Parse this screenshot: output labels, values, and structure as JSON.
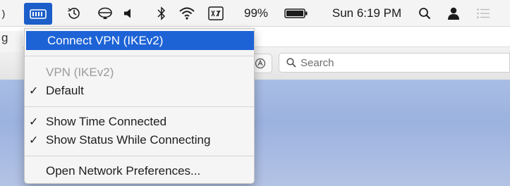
{
  "menubar": {
    "left_edge_glyph": ")",
    "items": [
      {
        "name": "vpn-status-icon"
      },
      {
        "name": "time-machine-icon"
      },
      {
        "name": "airplay-icon"
      },
      {
        "name": "volume-icon"
      },
      {
        "name": "bluetooth-icon"
      },
      {
        "name": "wifi-icon"
      },
      {
        "name": "input-source-icon"
      }
    ],
    "battery_percent": "99%",
    "clock": "Sun 6:19 PM"
  },
  "background": {
    "sliver_text": "g",
    "search_placeholder": "Search"
  },
  "vpn_menu": {
    "connect_label": "Connect VPN (IKEv2)",
    "vpn_name_label": "VPN (IKEv2)",
    "default_label": "Default",
    "show_time_label": "Show Time Connected",
    "show_status_label": "Show Status While Connecting",
    "open_prefs_label": "Open Network Preferences...",
    "check_glyph": "✓"
  },
  "colors": {
    "highlight": "#1d63d6",
    "vpn_icon_bg": "#1c5ec9"
  }
}
